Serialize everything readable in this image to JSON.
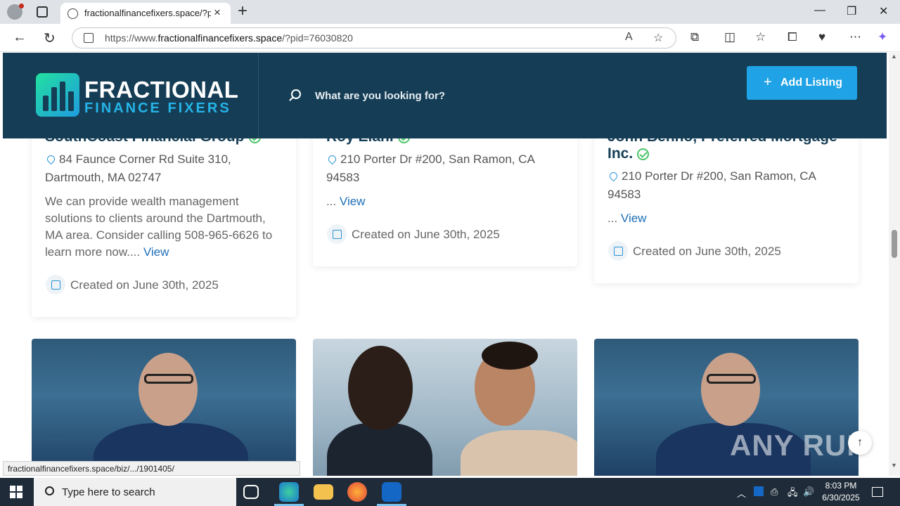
{
  "browser": {
    "tab_title": "fractionalfinancefixers.space/?pid=",
    "url_prefix": "https://www.",
    "url_domain": "fractionalfinancefixers.space",
    "url_path": "/?pid=76030820",
    "status_url": "fractionalfinancefixers.space/biz/.../1901405/"
  },
  "header": {
    "logo_line1": "FRACTIONAL",
    "logo_line2": "FINANCE FIXERS",
    "search_placeholder": "What are you looking for?",
    "add_listing_label": "Add Listing"
  },
  "listings": [
    {
      "title": "SouthCoast Financial Group",
      "address": "84 Faunce Corner Rd Suite 310, Dartmouth, MA 02747",
      "description": "We can provide wealth management solutions to clients around the Dartmouth, MA area. Consider calling 508-965-6626 to learn more now....",
      "view_label": "View",
      "created": "Created on June 30th, 2025"
    },
    {
      "title": "Roy Elani",
      "address": "210 Porter Dr #200, San Ramon, CA 94583",
      "description": "...",
      "view_label": "View",
      "created": "Created on June 30th, 2025"
    },
    {
      "title": "John Benno, Preferred Mortgage Inc.",
      "address": "210 Porter Dr #200, San Ramon, CA 94583",
      "description": "...",
      "view_label": "View",
      "created": "Created on June 30th, 2025"
    }
  ],
  "watermark": "ANY RUN",
  "taskbar": {
    "search_placeholder": "Type here to search",
    "time": "8:03 PM",
    "date": "6/30/2025"
  }
}
